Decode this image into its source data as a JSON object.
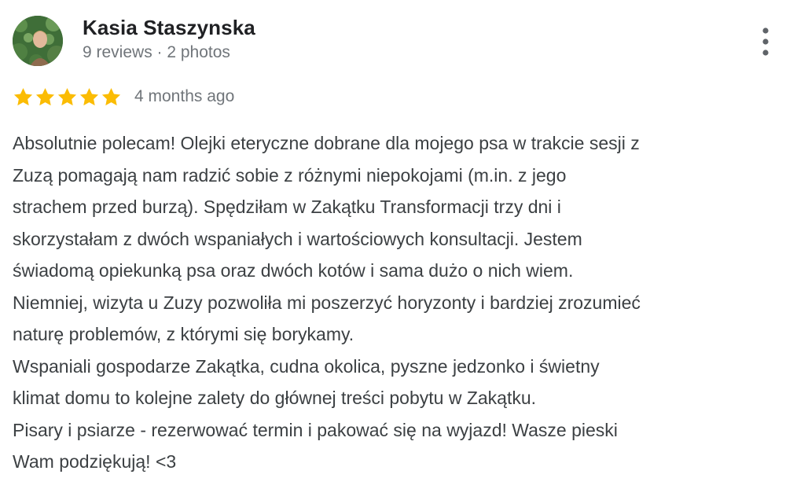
{
  "review": {
    "author": {
      "name": "Kasia Staszynska",
      "meta": "9 reviews · 2 photos",
      "avatar_icon": "profile-photo"
    },
    "more_icon": "more-vertical-icon",
    "rating": {
      "stars": 5,
      "max": 5,
      "star_color": "#fbbc04"
    },
    "time_ago": "4 months ago",
    "text_lines": [
      "Absolutnie polecam! Olejki eteryczne dobrane dla mojego psa w trakcie sesji z",
      "Zuzą pomagają nam radzić sobie z różnymi niepokojami (m.in. z jego",
      "strachem przed burzą). Spędziłam w Zakątku Transformacji trzy dni i",
      "skorzystałam z dwóch wspaniałych i wartościowych konsultacji. Jestem",
      "świadomą opiekunką psa oraz dwóch kotów i sama dużo o nich wiem.",
      "Niemniej, wizyta u Zuzy pozwoliła mi poszerzyć horyzonty i bardziej zrozumieć",
      "naturę problemów, z którymi się borykamy.",
      "Wspaniali gospodarze Zakątka, cudna okolica, pyszne jedzonko i świetny",
      "klimat domu to kolejne zalety do głównej treści pobytu w Zakątku.",
      "Pisary i psiarze - rezerwować termin i pakować się na wyjazd! Wasze pieski",
      "Wam podziękują! <3"
    ]
  }
}
